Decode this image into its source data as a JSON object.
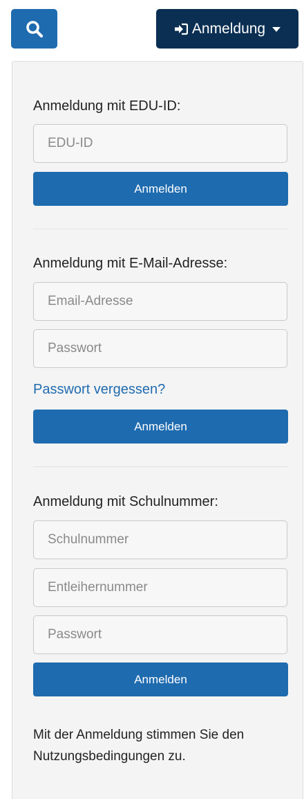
{
  "header": {
    "login_toggle_label": "Anmeldung"
  },
  "edu_id": {
    "heading": "Anmeldung mit EDU-ID:",
    "id_placeholder": "EDU-ID",
    "submit_label": "Anmelden"
  },
  "email": {
    "heading": "Anmeldung mit E-Mail-Adresse:",
    "email_placeholder": "Email-Adresse",
    "password_placeholder": "Passwort",
    "forgot_label": "Passwort vergessen?",
    "submit_label": "Anmelden"
  },
  "school": {
    "heading": "Anmeldung mit Schulnummer:",
    "school_number_placeholder": "Schulnummer",
    "borrower_number_placeholder": "Entleihernummer",
    "password_placeholder": "Passwort",
    "submit_label": "Anmelden"
  },
  "terms": {
    "text": "Mit der Anmeldung stimmen Sie den Nutzungsbedingungen zu."
  },
  "icons": {
    "search": "search-icon",
    "login": "sign-in-icon",
    "caret": "caret-down-icon"
  },
  "colors": {
    "primary": "#1f6bb0",
    "dark": "#0b2f52",
    "panel": "#f4f4f4"
  }
}
